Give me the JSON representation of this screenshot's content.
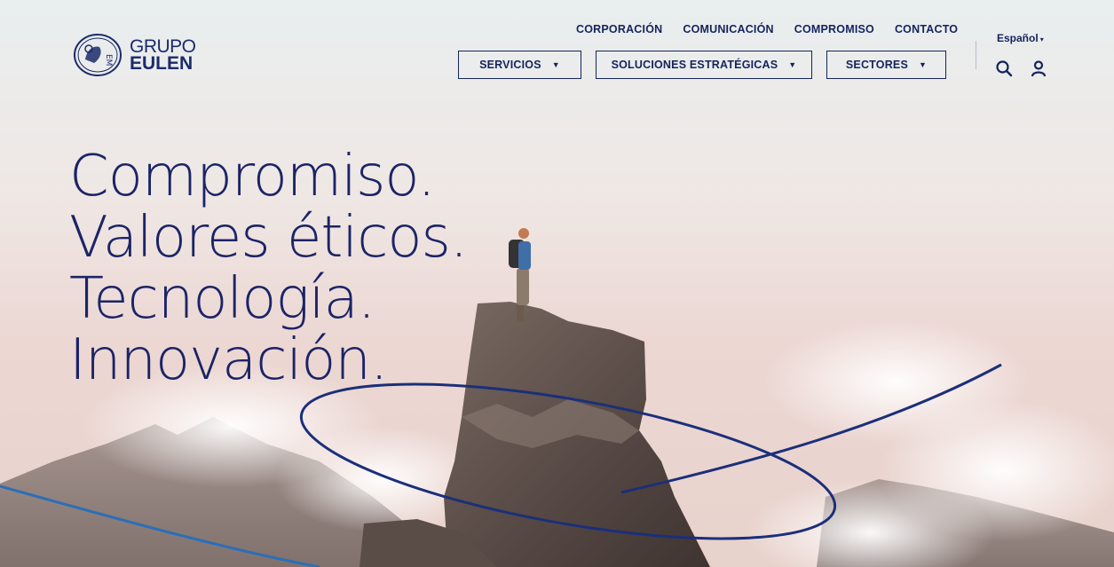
{
  "brand": {
    "line1": "GRUPO",
    "line2": "EULEN",
    "emblem": "eulen-emblem-icon"
  },
  "top_nav": [
    "CORPORACIÓN",
    "COMUNICACIÓN",
    "COMPROMISO",
    "CONTACTO"
  ],
  "main_nav": [
    {
      "label": "SERVICIOS",
      "caret": "▼"
    },
    {
      "label": "SOLUCIONES ESTRATÉGICAS",
      "caret": "▼"
    },
    {
      "label": "SECTORES",
      "caret": "▼"
    }
  ],
  "language": {
    "label": "Español",
    "caret": "▾"
  },
  "icons": {
    "search": "search-icon",
    "user": "user-icon"
  },
  "hero": {
    "lines": [
      "Compromiso.",
      "Valores éticos.",
      "Tecnología.",
      "Innovación."
    ]
  },
  "colors": {
    "brand_navy": "#14245c",
    "swoosh": "#1b2f7a",
    "swoosh_light": "#2a6fb8"
  }
}
